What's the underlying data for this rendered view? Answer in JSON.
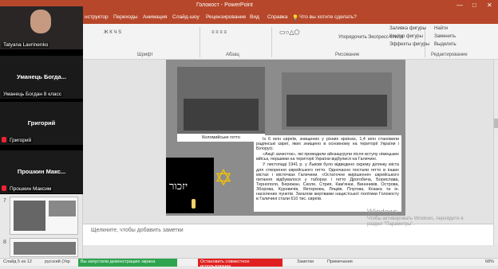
{
  "app": {
    "title": "Голокост - PowerPoint"
  },
  "window_controls": [
    "—",
    "□",
    "✕"
  ],
  "tabs": [
    "нструктор",
    "Переходы",
    "Анимация",
    "Слайд-шоу",
    "Рецензирование",
    "Вид",
    "Справка",
    "Что вы хотите сделать?"
  ],
  "ribbon": {
    "groups": [
      "Шрифт",
      "Абзац",
      "Рисование",
      "Редактирование"
    ],
    "buttons": {
      "arrange": "Упорядочить",
      "styles": "Экспресс-стили",
      "fill": "Заливка фигуры",
      "outline": "Контур фигуры",
      "effects": "Эффекты фигуры",
      "find": "Найти",
      "replace": "Заменить",
      "select": "Выделить"
    }
  },
  "participants": [
    {
      "top_name": "",
      "label": "Tatyana Lavrinenko",
      "big": ""
    },
    {
      "top_name": "Уманець Богда...",
      "label": "Уманець Богдан 8 класс",
      "big": ""
    },
    {
      "top_name": "Григорий",
      "label": "Григорий",
      "big": ""
    },
    {
      "top_name": "Прошкин Макс...",
      "label": "Прошкин Максим",
      "big": ""
    }
  ],
  "thumbnails": [
    {
      "num": "7"
    },
    {
      "num": "8"
    }
  ],
  "slide": {
    "caption": "Коломийське гетто",
    "star": "JUDE",
    "hebrew": "יזכור",
    "paragraphs": [
      "Із 6 млн євреїв, знищених у різних країнах, 1,4 млн становили радянські євреї, яких знищено в основному на території України і Білорусі.",
      "«Акції зачисток», які проводили айнзацгрупи після вступу німецьких військ, першими на території України відбулися на Галичині.",
      "У листопаді 1941 р. у Львові було відведено окрему ділянку міста для створення єврейського гетто. Одночасно постали гетто в інших містах і містечках Галичини. «Остаточне вирішення» єврейського питання відбувалося у таборах і гетто Дрогобича, Борислава, Тернополя, Бережан, Сколе, Стрия, Кам'янки, Виннників, Острова, Зборова, Куровичів, Якторкова, Ляцків, Плугова, Козака та ін. населених пунктів. Загалом жертвами нацистської політики Голокосту в Галичині стали 610 тис. євреїв."
    ]
  },
  "notes": {
    "placeholder": "Щелкните, чтобы добавить заметки"
  },
  "watermark": {
    "line1": "Windows",
    "line2": "Чтобы активировать Windows, перейдите в",
    "line3": "раздел \"Параметры\"."
  },
  "status": {
    "slide": "Слайд 5 из 12",
    "lang": "русский (Укр",
    "demo": "Вы запустили демонстрацию экрана",
    "stop": "Остановить совместное использование",
    "notes": "Заметки",
    "comments": "Примечания",
    "zoom": "68%"
  },
  "colors": {
    "accent": "#b7472a",
    "green": "#2ea44f",
    "red": "#e02020"
  }
}
